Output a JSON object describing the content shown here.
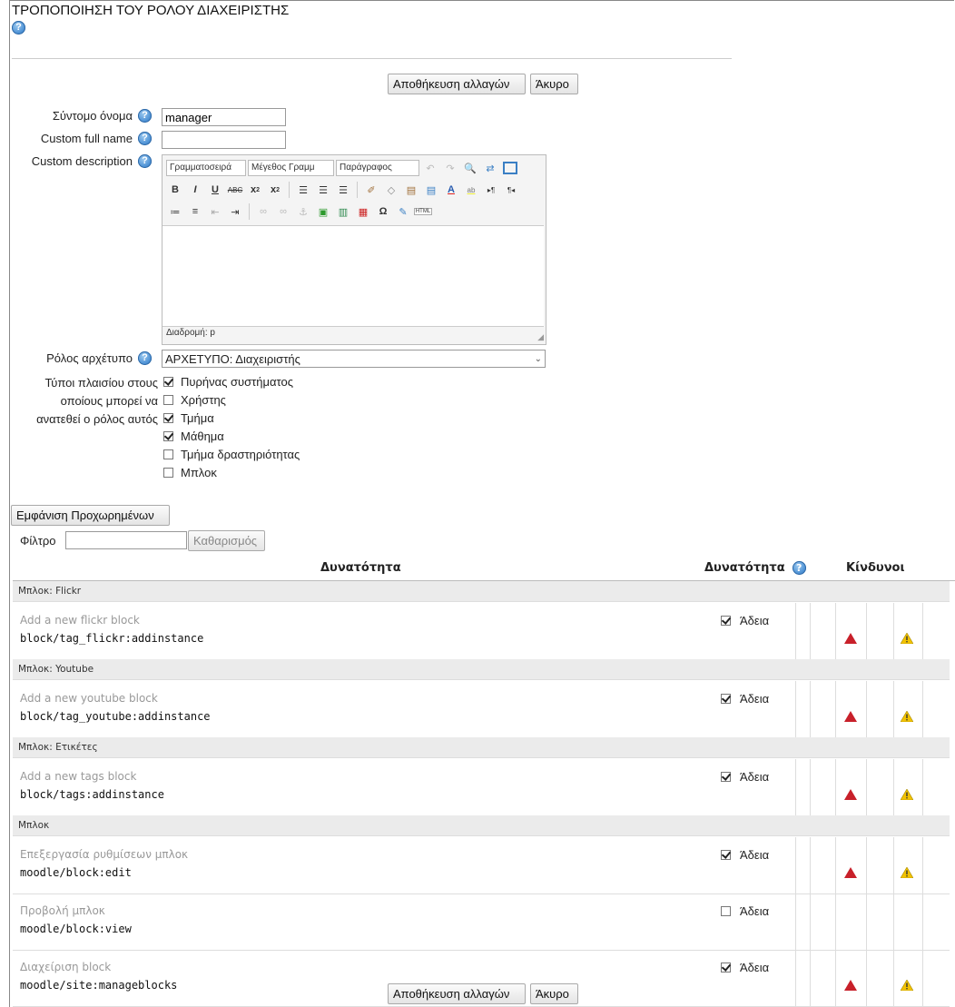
{
  "page": {
    "title": "ΤΡΟΠΟΠΟΙΗΣΗ ΤΟΥ ΡΟΛΟΥ ΔΙΑΧΕΙΡΙΣΤΗΣ"
  },
  "buttons": {
    "save": "Αποθήκευση αλλαγών",
    "cancel": "Άκυρο",
    "advanced": "Εμφάνιση Προχωρημένων",
    "clear": "Καθαρισμός"
  },
  "form": {
    "shortname": {
      "label": "Σύντομο όνομα",
      "value": "manager"
    },
    "fullname": {
      "label": "Custom full name",
      "value": ""
    },
    "description": {
      "label": "Custom description"
    },
    "archetype": {
      "label": "Ρόλος αρχέτυπο",
      "value": "ΑΡΧΕΤΥΠΟ: Διαχειριστής"
    },
    "contexts": {
      "label_lines": [
        "Τύποι πλαισίου στους",
        "οποίους μπορεί να",
        "ανατεθεί ο ρόλος αυτός"
      ],
      "items": [
        {
          "label": "Πυρήνας συστήματος",
          "checked": true
        },
        {
          "label": "Χρήστης",
          "checked": false
        },
        {
          "label": "Τμήμα",
          "checked": true
        },
        {
          "label": "Μάθημα",
          "checked": true
        },
        {
          "label": "Τμήμα δραστηριότητας",
          "checked": false
        },
        {
          "label": "Μπλοκ",
          "checked": false
        }
      ]
    }
  },
  "editor": {
    "font_family": "Γραμματοσειρά",
    "font_size": "Μέγεθος Γραμμ",
    "paragraph": "Παράγραφος",
    "path": "Διαδρομή: p",
    "html_btn": "HTML"
  },
  "filter": {
    "label": "Φίλτρο",
    "value": ""
  },
  "table": {
    "headers": {
      "capability": "Δυνατότητα",
      "permission": "Δυνατότητα",
      "risks": "Κίνδυνοι"
    },
    "rows": [
      {
        "type": "group",
        "label": "Μπλοκ: Flickr"
      },
      {
        "type": "cap",
        "name": "Add a new flickr block",
        "id": "block/tag_flickr:addinstance",
        "perm_label": "Άδεια",
        "checked": true,
        "risks": true
      },
      {
        "type": "group",
        "label": "Μπλοκ: Youtube"
      },
      {
        "type": "cap",
        "name": "Add a new youtube block",
        "id": "block/tag_youtube:addinstance",
        "perm_label": "Άδεια",
        "checked": true,
        "risks": true
      },
      {
        "type": "group",
        "label": "Μπλοκ: Ετικέτες"
      },
      {
        "type": "cap",
        "name": "Add a new tags block",
        "id": "block/tags:addinstance",
        "perm_label": "Άδεια",
        "checked": true,
        "risks": true
      },
      {
        "type": "group",
        "label": "Μπλοκ"
      },
      {
        "type": "cap",
        "name": "Επεξεργασία ρυθμίσεων μπλοκ",
        "id": "moodle/block:edit",
        "perm_label": "Άδεια",
        "checked": true,
        "risks": true
      },
      {
        "type": "cap",
        "name": "Προβολή μπλοκ",
        "id": "moodle/block:view",
        "perm_label": "Άδεια",
        "checked": false,
        "risks": false
      },
      {
        "type": "cap",
        "name": "Διαχείριση block",
        "id": "moodle/site:manageblocks",
        "perm_label": "Άδεια",
        "checked": true,
        "risks": true
      }
    ]
  },
  "colors": {
    "risk_red": "#c8202a",
    "risk_yellow": "#f2c200",
    "help_blue": "#4f93d6",
    "group_bg": "#ebebeb"
  }
}
